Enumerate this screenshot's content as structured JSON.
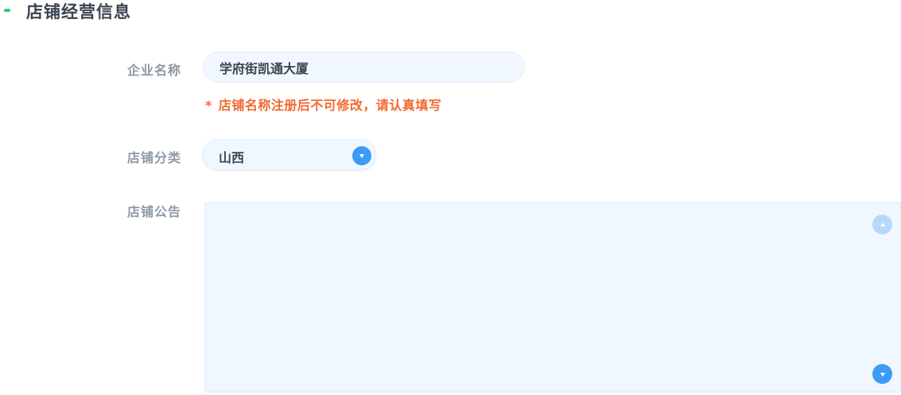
{
  "section": {
    "title": "店铺经营信息"
  },
  "company_name": {
    "label": "企业名称",
    "value": "学府街凯通大厦",
    "hint_star": "*",
    "hint_text": "店铺名称注册后不可修改，请认真填写"
  },
  "category": {
    "label": "店铺分类",
    "selected": "山西"
  },
  "announcement": {
    "label": "店铺公告",
    "value": ""
  },
  "colors": {
    "accent_green": "#2ecc71",
    "warning_orange": "#f2692f",
    "primary_blue": "#3b9bf5",
    "input_bg": "#f1f7fe"
  }
}
